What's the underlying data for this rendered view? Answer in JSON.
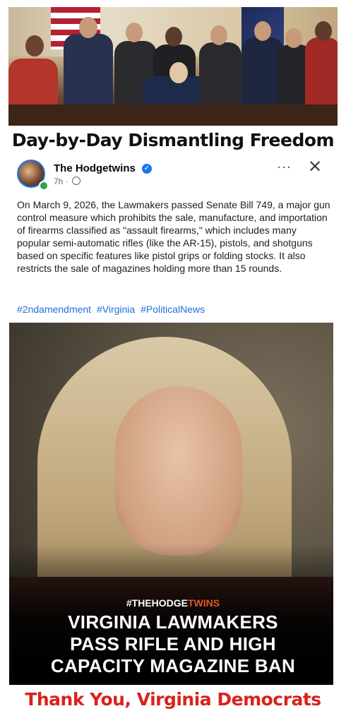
{
  "headline": "Day-by-Day Dismantling Freedom",
  "post": {
    "author": "The Hodgetwins",
    "time": "7h",
    "separator": "·",
    "body": "On March 9, 2026, the Lawmakers passed Senate Bill 749, a major gun control measure which prohibits the sale, manufacture, and importation of firearms classified as \"assault firearms,\" which includes many popular semi-automatic rifles (like the AR-15), pistols, and shotguns based on specific features like pistol grips or folding stocks. It also restricts the sale of magazines holding more than 15 rounds.",
    "hashtags": [
      "#2ndamendment",
      "#Virginia",
      "#PoliticalNews"
    ],
    "more_label": "···",
    "close_label": "✕"
  },
  "image_overlay": {
    "tag_prefix": "#THEHODGE",
    "tag_accent": "TWINS",
    "title_line1": "VIRGINIA LAWMAKERS",
    "title_line2": "PASS RIFLE AND HIGH",
    "title_line3": "CAPACITY MAGAZINE BAN"
  },
  "footer": "Thank You, Virginia Democrats",
  "colors": {
    "link": "#216fdb",
    "footer": "#d8231c",
    "verified": "#1877f2",
    "tag_accent": "#e2552b"
  },
  "icons": [
    "verified-icon",
    "globe-icon",
    "more-icon",
    "close-icon"
  ]
}
